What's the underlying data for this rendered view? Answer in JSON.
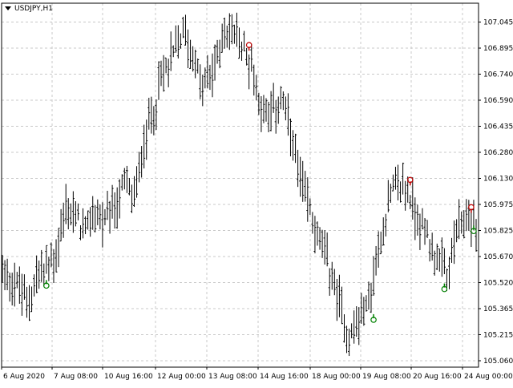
{
  "window": {
    "symbol_label": "USDJPY,H1",
    "menu_icon": "triangle-down-icon"
  },
  "colors": {
    "background": "#ffffff",
    "grid": "#c8c8c8",
    "bars": "#000000",
    "axis": "#000000",
    "signal_sell": "#c00000",
    "signal_buy": "#008000"
  },
  "chart_data": {
    "type": "ohlc-bar",
    "symbol": "USDJPY",
    "timeframe": "H1",
    "grid": true,
    "y_axis_position": "right",
    "ylim": [
      105.06,
      107.11
    ],
    "y_ticks": [
      "107.045",
      "106.895",
      "106.740",
      "106.590",
      "106.435",
      "106.280",
      "106.130",
      "105.975",
      "105.825",
      "105.670",
      "105.520",
      "105.365",
      "105.215",
      "105.060"
    ],
    "x_ticks": [
      "6 Aug 2020",
      "7 Aug 08:00",
      "10 Aug 16:00",
      "12 Aug 00:00",
      "13 Aug 08:00",
      "14 Aug 16:00",
      "18 Aug 00:00",
      "19 Aug 08:00",
      "20 Aug 16:00",
      "24 Aug 00:00"
    ],
    "price_path": [
      {
        "i": 0,
        "p": 105.6
      },
      {
        "i": 6,
        "p": 105.5
      },
      {
        "i": 10,
        "p": 105.4
      },
      {
        "i": 14,
        "p": 105.55
      },
      {
        "i": 18,
        "p": 105.6
      },
      {
        "i": 22,
        "p": 105.68
      },
      {
        "i": 26,
        "p": 105.95
      },
      {
        "i": 30,
        "p": 105.9
      },
      {
        "i": 34,
        "p": 105.8
      },
      {
        "i": 38,
        "p": 105.95
      },
      {
        "i": 42,
        "p": 105.85
      },
      {
        "i": 46,
        "p": 105.95
      },
      {
        "i": 50,
        "p": 106.1
      },
      {
        "i": 54,
        "p": 106.0
      },
      {
        "i": 58,
        "p": 106.35
      },
      {
        "i": 62,
        "p": 106.55
      },
      {
        "i": 66,
        "p": 106.75
      },
      {
        "i": 70,
        "p": 106.85
      },
      {
        "i": 74,
        "p": 107.0
      },
      {
        "i": 78,
        "p": 106.85
      },
      {
        "i": 82,
        "p": 106.65
      },
      {
        "i": 86,
        "p": 106.75
      },
      {
        "i": 90,
        "p": 106.95
      },
      {
        "i": 94,
        "p": 107.0
      },
      {
        "i": 98,
        "p": 106.9
      },
      {
        "i": 102,
        "p": 106.8
      },
      {
        "i": 106,
        "p": 106.55
      },
      {
        "i": 110,
        "p": 106.5
      },
      {
        "i": 114,
        "p": 106.6
      },
      {
        "i": 118,
        "p": 106.4
      },
      {
        "i": 122,
        "p": 106.1
      },
      {
        "i": 126,
        "p": 105.95
      },
      {
        "i": 130,
        "p": 105.75
      },
      {
        "i": 134,
        "p": 105.6
      },
      {
        "i": 138,
        "p": 105.4
      },
      {
        "i": 142,
        "p": 105.2
      },
      {
        "i": 146,
        "p": 105.3
      },
      {
        "i": 150,
        "p": 105.4
      },
      {
        "i": 154,
        "p": 105.7
      },
      {
        "i": 158,
        "p": 106.0
      },
      {
        "i": 162,
        "p": 106.1
      },
      {
        "i": 166,
        "p": 106.05
      },
      {
        "i": 170,
        "p": 105.9
      },
      {
        "i": 174,
        "p": 105.8
      },
      {
        "i": 178,
        "p": 105.65
      },
      {
        "i": 182,
        "p": 105.55
      },
      {
        "i": 186,
        "p": 105.8
      },
      {
        "i": 190,
        "p": 105.9
      },
      {
        "i": 194,
        "p": 105.85
      }
    ],
    "bar_count": 195,
    "signals": [
      {
        "type": "sell",
        "bar": 101,
        "price": 106.91
      },
      {
        "type": "sell",
        "bar": 167,
        "price": 106.12
      },
      {
        "type": "sell",
        "bar": 192,
        "price": 105.96
      },
      {
        "type": "buy",
        "bar": 18,
        "price": 105.5
      },
      {
        "type": "buy",
        "bar": 152,
        "price": 105.3
      },
      {
        "type": "buy",
        "bar": 181,
        "price": 105.48
      },
      {
        "type": "buy",
        "bar": 193,
        "price": 105.82
      }
    ]
  }
}
